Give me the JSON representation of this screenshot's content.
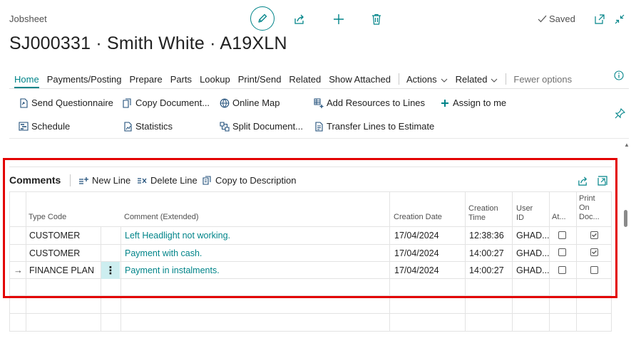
{
  "header": {
    "caption": "Jobsheet",
    "title": "SJ000331 · Smith White · A19XLN",
    "saved_label": "Saved",
    "colors": {
      "accent": "#008489"
    }
  },
  "tabs": [
    "Home",
    "Payments/Posting",
    "Prepare",
    "Parts",
    "Lookup",
    "Print/Send",
    "Related",
    "Show Attached"
  ],
  "tab_menus": [
    "Actions",
    "Related"
  ],
  "fewer_options": "Fewer options",
  "actions": {
    "send_questionnaire": "Send Questionnaire",
    "copy_document": "Copy Document...",
    "online_map": "Online Map",
    "add_resources": "Add Resources to Lines",
    "assign_to_me": "Assign to me",
    "schedule": "Schedule",
    "statistics": "Statistics",
    "split_document": "Split Document...",
    "transfer_lines": "Transfer Lines to Estimate"
  },
  "comments": {
    "title": "Comments",
    "new_line": "New Line",
    "delete_line": "Delete Line",
    "copy_to_description": "Copy to Description",
    "columns": {
      "type_code": "Type Code",
      "comment": "Comment (Extended)",
      "creation_date": "Creation Date",
      "creation_time_1": "Creation",
      "creation_time_2": "Time",
      "user_id_1": "User",
      "user_id_2": "ID",
      "attached": "At...",
      "print_1": "Print",
      "print_2": "On",
      "print_3": "Doc..."
    },
    "rows": [
      {
        "type_code": "CUSTOMER",
        "comment": "Left Headlight not working.",
        "date": "17/04/2024",
        "time": "12:38:36",
        "user": "GHAD...",
        "attached": false,
        "print_on_doc": true
      },
      {
        "type_code": "CUSTOMER",
        "comment": "Payment with cash.",
        "date": "17/04/2024",
        "time": "14:00:27",
        "user": "GHAD...",
        "attached": false,
        "print_on_doc": true
      },
      {
        "type_code": "FINANCE PLAN",
        "comment": "Payment in instalments.",
        "date": "17/04/2024",
        "time": "14:00:27",
        "user": "GHAD...",
        "attached": false,
        "print_on_doc": false
      }
    ]
  }
}
